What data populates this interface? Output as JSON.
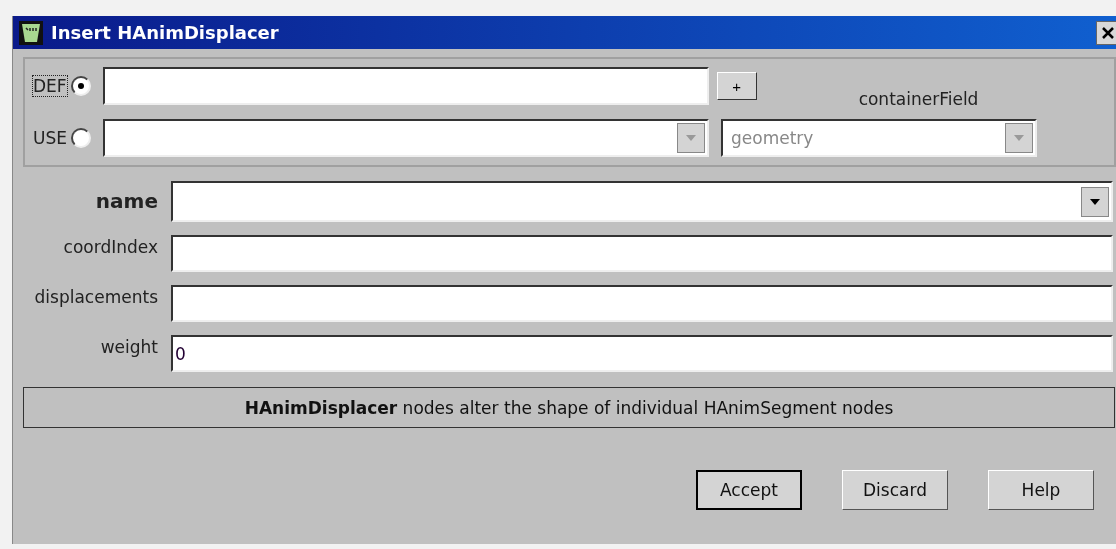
{
  "window": {
    "title": "Insert HAnimDisplacer"
  },
  "node_options": [
    {
      "label": "DEF",
      "selected": true,
      "focused": true,
      "kind": "text"
    },
    {
      "label": "USE",
      "selected": false,
      "focused": false,
      "kind": "combo"
    }
  ],
  "add_button": "+",
  "container_field": {
    "label": "containerField",
    "value": "geometry"
  },
  "fields": [
    {
      "label": "name",
      "kind": "combo",
      "required": true
    },
    {
      "label": "coordIndex",
      "kind": "text",
      "required": false
    },
    {
      "label": "displacements",
      "kind": "text",
      "required": false
    },
    {
      "label": "weight",
      "kind": "text",
      "required": false,
      "value": "0"
    }
  ],
  "description": "**HAnimDisplacer** nodes alter the shape of individual HAnimSegment nodes",
  "buttons": [
    "Accept",
    "Discard",
    "Help"
  ]
}
